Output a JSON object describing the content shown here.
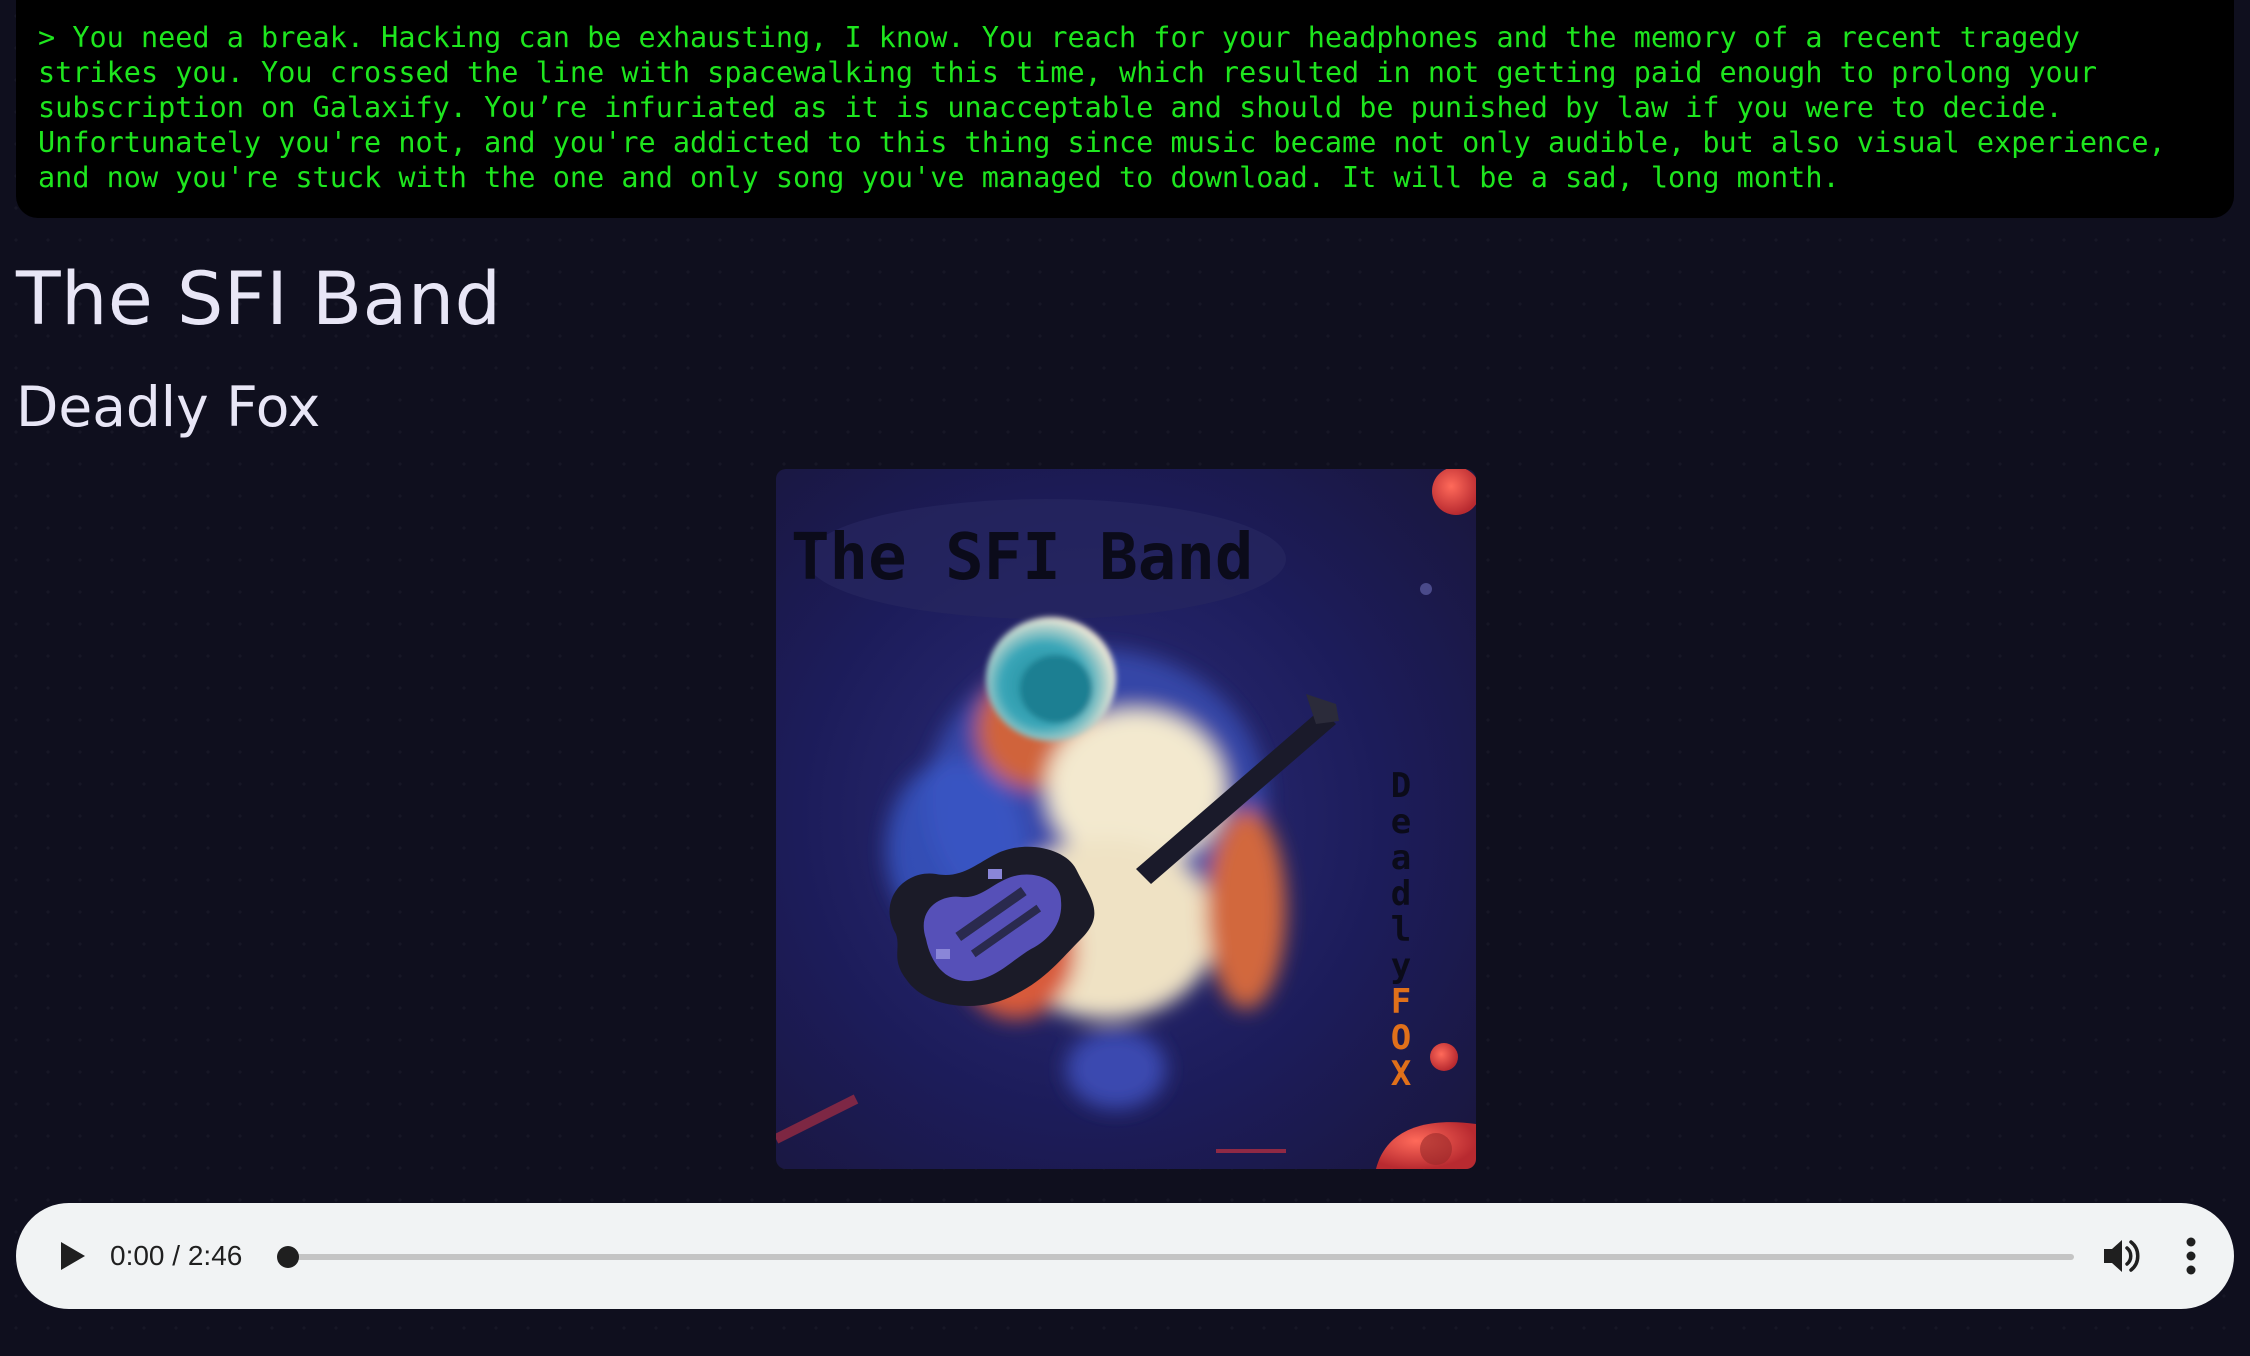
{
  "terminal": {
    "text": "> You need a break. Hacking can be exhausting, I know. You reach for your headphones and the memory of a recent tragedy strikes you. You crossed the line with spacewalking this time, which resulted in not getting paid enough to prolong your subscription on Galaxify. You’re infuriated as it is unacceptable and should be punished by law if you were to decide. Unfortunately you're not, and you're addicted to this thing since music became not only audible, but also visual experience, and now you're stuck with the one and only song you've managed to download. It will be a sad, long month."
  },
  "track": {
    "band": "The SFI Band",
    "song": "Deadly Fox"
  },
  "cover": {
    "band_lettering": "The SFI Band",
    "side_lettering_deadly": "Deadly",
    "side_lettering_fox": "FOX",
    "colors": {
      "background": "#1c1c5a",
      "lettering_dark": "#0b0b1a",
      "lettering_fox": "#e0701a",
      "planet_red": "#e0404a"
    }
  },
  "player": {
    "time_current": "0:00",
    "time_separator": " / ",
    "time_total": "2:46",
    "progress": 0,
    "icons": {
      "play": "play-icon",
      "volume": "volume-icon",
      "menu": "more-vert-icon"
    }
  },
  "colors": {
    "page_background": "#0f0f1e",
    "terminal_background": "#000000",
    "terminal_text": "#1ee61e",
    "title_text": "#e8e6f6",
    "player_background": "#f1f3f4"
  }
}
